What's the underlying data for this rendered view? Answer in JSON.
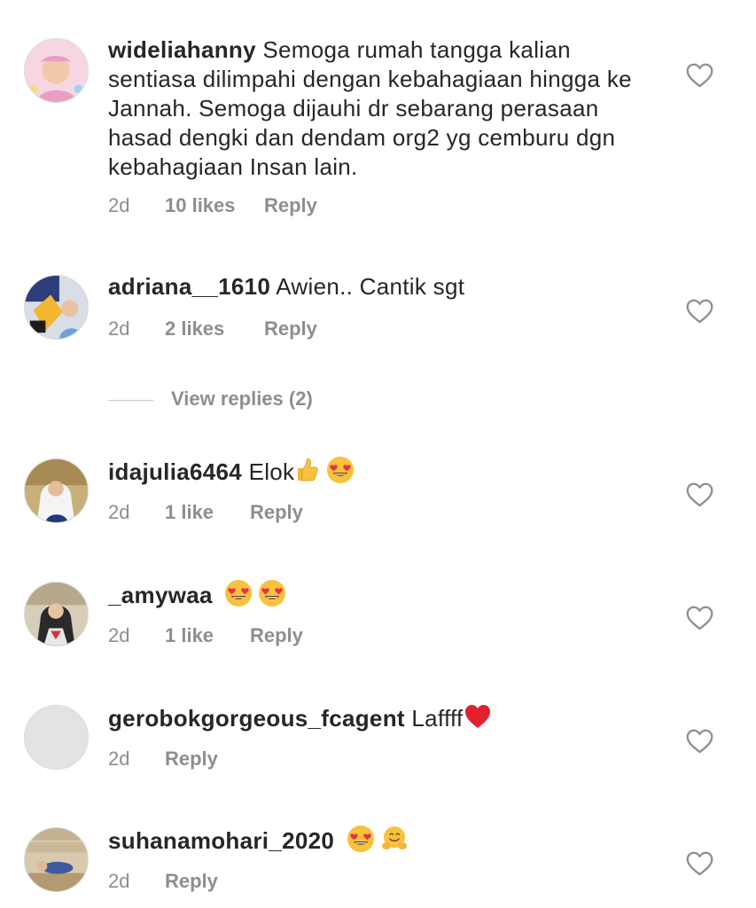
{
  "comments": [
    {
      "username": "wideliahanny",
      "text": "Semoga rumah tangga kalian sentiasa dilimpahi dengan kebahagiaan hingga ke Jannah. Semoga dijauhi dr sebarang perasaan hasad dengki dan dendam org2 yg cemburu dgn kebahagiaan Insan lain.",
      "time": "2d",
      "likes": "10 likes",
      "reply": "Reply"
    },
    {
      "username": "adriana__1610",
      "text": "Awien.. Cantik sgt",
      "time": "2d",
      "likes": "2 likes",
      "reply": "Reply"
    },
    {
      "username": "idajulia6464",
      "text": "Elok",
      "emojis": [
        "thumbs-up-emoji",
        "heart-eyes-emoji"
      ],
      "time": "2d",
      "likes": "1 like",
      "reply": "Reply"
    },
    {
      "username": "_amywaa",
      "text": "",
      "emojis": [
        "heart-eyes-emoji",
        "heart-eyes-emoji"
      ],
      "time": "2d",
      "likes": "1 like",
      "reply": "Reply"
    },
    {
      "username": "gerobokgorgeous_fcagent",
      "text": "Laffff",
      "emojis": [
        "red-heart-emoji"
      ],
      "time": "2d",
      "reply": "Reply"
    },
    {
      "username": "suhanamohari_2020",
      "text": "",
      "emojis": [
        "heart-eyes-emoji",
        "hugging-face-emoji"
      ],
      "time": "2d",
      "reply": "Reply"
    }
  ],
  "view_replies": "View replies (2)",
  "colors": {
    "text": "#262626",
    "meta": "#8e8e8e",
    "heart_outline": "#8e8e8e"
  },
  "icons": [
    "heart-outline-icon",
    "avatar"
  ]
}
